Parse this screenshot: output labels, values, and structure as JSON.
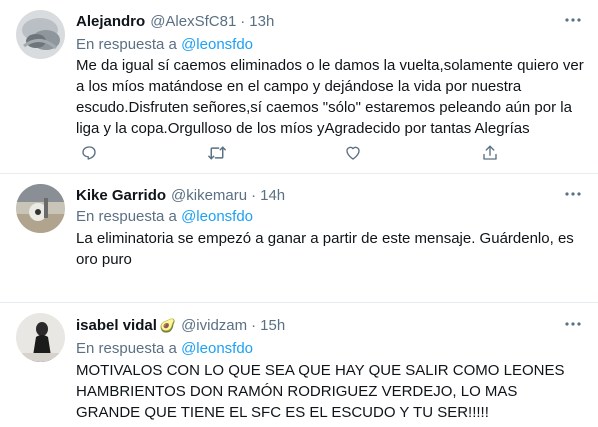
{
  "tweets": [
    {
      "name": "Alejandro",
      "emoji": "",
      "handle": "@AlexSfC81",
      "separator": "·",
      "time": "13h",
      "reply_prefix": "En respuesta a",
      "reply_to": "@leonsfdo",
      "text": "Me da igual sí caemos eliminados o le damos la vuelta,solamente quiero ver a los míos matándose en el campo y dejándose la vida por nuestra escudo.Disfruten señores,sí caemos \"sólo\" estaremos peleando aún por la liga y la copa.Orgulloso de los míos yAgradecido por tantas Alegrías"
    },
    {
      "name": "Kike Garrido",
      "emoji": "",
      "handle": "@kikemaru",
      "separator": "·",
      "time": "14h",
      "reply_prefix": "En respuesta a",
      "reply_to": "@leonsfdo",
      "text": "La eliminatoria se empezó a ganar a partir de este mensaje. Guárdenlo, es oro puro"
    },
    {
      "name": "isabel vidal",
      "emoji": "🥑",
      "handle": "@ividzam",
      "separator": "·",
      "time": "15h",
      "reply_prefix": "En respuesta a",
      "reply_to": "@leonsfdo",
      "text": "MOTIVALOS CON LO QUE SEA QUE HAY QUE SALIR COMO LEONES HAMBRIENTOS DON RAMÓN RODRIGUEZ VERDEJO, LO MAS GRANDE QUE TIENE EL SFC ES EL ESCUDO Y TU SER!!!!!"
    }
  ],
  "icons": {
    "more": "more-horizontal-icon",
    "reply": "reply-icon",
    "retweet": "retweet-icon",
    "like": "like-icon",
    "share": "share-icon"
  },
  "colors": {
    "secondary_text": "#5b7083",
    "link": "#1da1f2",
    "divider": "#e6ecf0",
    "avocado": "#8bc34a"
  }
}
